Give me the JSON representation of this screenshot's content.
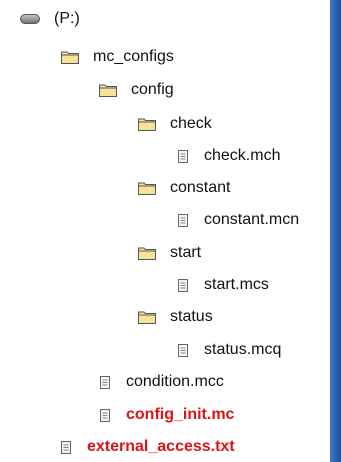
{
  "tree": {
    "drive": {
      "label": "(P:)",
      "icon": "drive-icon"
    },
    "mc_configs": {
      "label": "mc_configs",
      "icon": "folder-icon"
    },
    "config": {
      "label": "config",
      "icon": "folder-icon"
    },
    "check": {
      "label": "check",
      "icon": "folder-icon"
    },
    "check_file": {
      "label": "check.mch",
      "icon": "file-icon"
    },
    "constant": {
      "label": "constant",
      "icon": "folder-icon"
    },
    "constant_file": {
      "label": "constant.mcn",
      "icon": "file-icon"
    },
    "start": {
      "label": "start",
      "icon": "folder-icon"
    },
    "start_file": {
      "label": "start.mcs",
      "icon": "file-icon"
    },
    "status": {
      "label": "status",
      "icon": "folder-icon"
    },
    "status_file": {
      "label": "status.mcq",
      "icon": "file-icon"
    },
    "condition_file": {
      "label": "condition.mcc",
      "icon": "file-icon"
    },
    "config_init_file": {
      "label": "config_init.mc",
      "icon": "file-icon",
      "highlight": true
    },
    "external_access_file": {
      "label": "external_access.txt",
      "icon": "file-icon",
      "highlight": true
    }
  },
  "colors": {
    "highlight_text": "#e01313",
    "folder_fill": "#f5e39a",
    "background_edge": "#2b64b7"
  }
}
